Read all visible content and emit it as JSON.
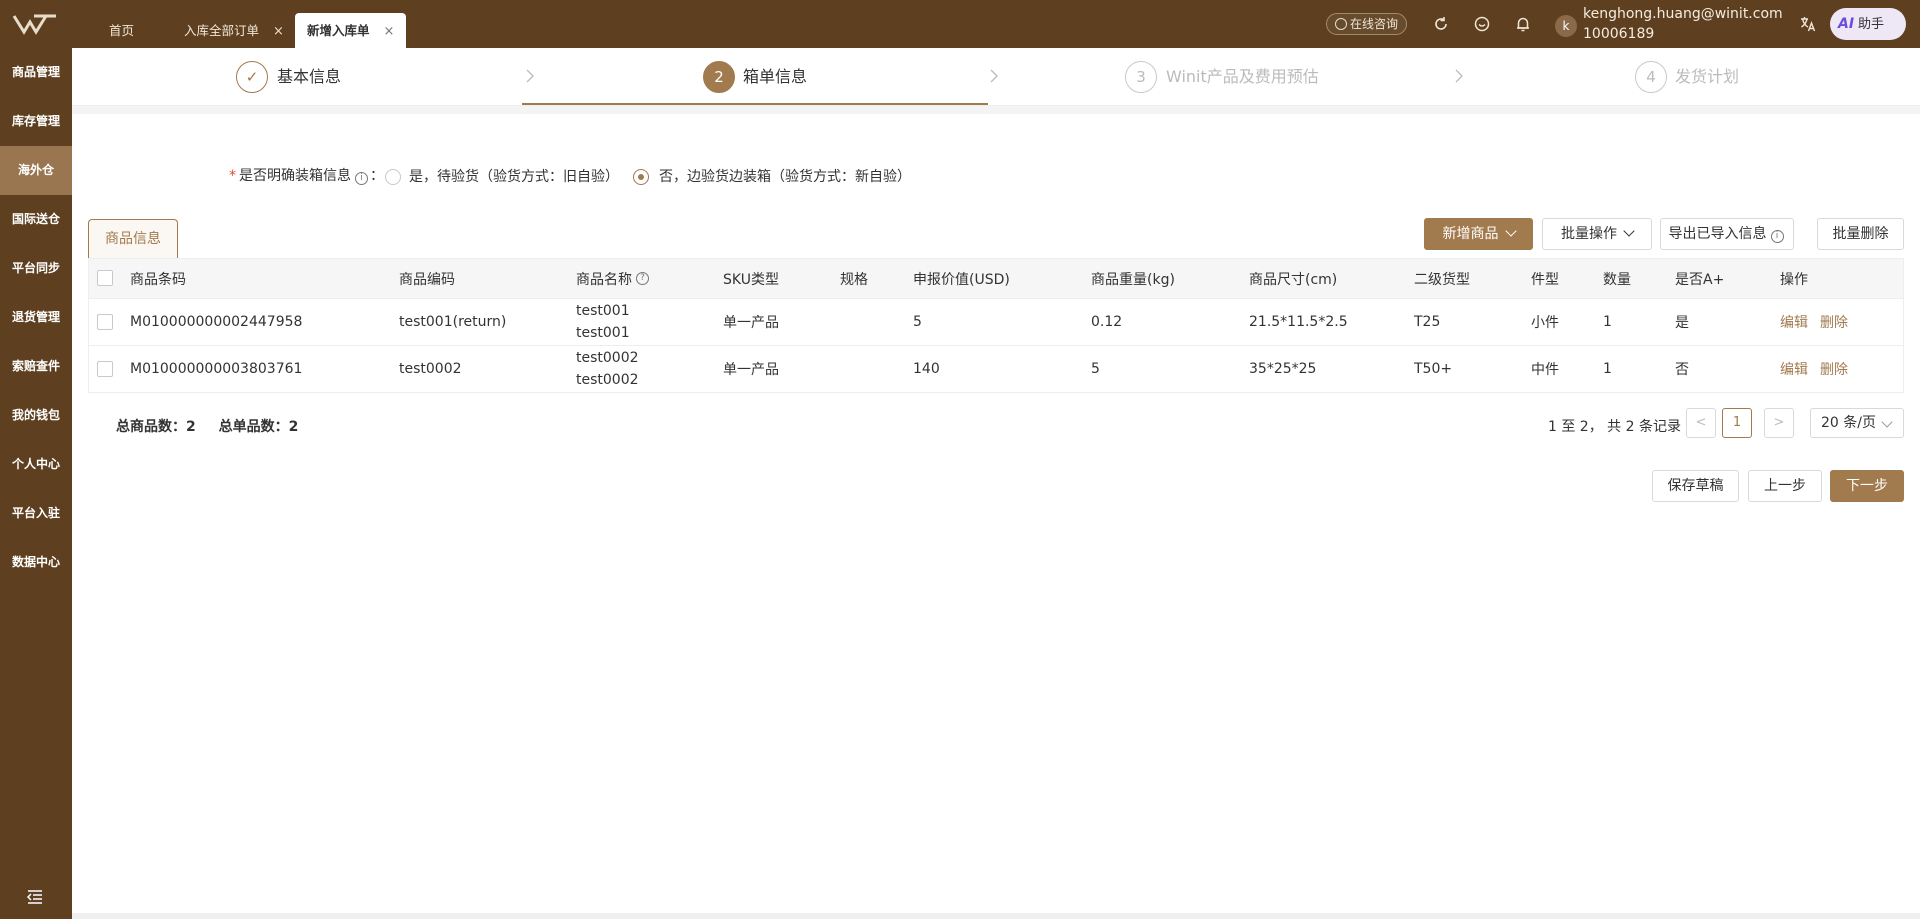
{
  "tabs": [
    {
      "label": "首页",
      "closable": false
    },
    {
      "label": "入库全部订单",
      "closable": true
    },
    {
      "label": "新增入库单",
      "closable": true,
      "active": true
    }
  ],
  "header": {
    "consult_label": "在线咨询",
    "user_avatar": "k",
    "user_email": "kenghong.huang@winit.com",
    "user_id": "10006189",
    "ai_prefix": "AI",
    "ai_label": "助手",
    "close_glyph": "×"
  },
  "sidebar": {
    "items": [
      {
        "label": "商品管理"
      },
      {
        "label": "库存管理"
      },
      {
        "label": "海外仓",
        "active": true
      },
      {
        "label": "国际送仓"
      },
      {
        "label": "平台同步"
      },
      {
        "label": "退货管理"
      },
      {
        "label": "索赔查件"
      },
      {
        "label": "我的钱包"
      },
      {
        "label": "个人中心"
      },
      {
        "label": "平台入驻"
      },
      {
        "label": "数据中心"
      }
    ]
  },
  "steps": [
    {
      "number": "✓",
      "label": "基本信息",
      "state": "done"
    },
    {
      "number": "2",
      "label": "箱单信息",
      "state": "current"
    },
    {
      "number": "3",
      "label": "Winit产品及费用预估",
      "state": "todo"
    },
    {
      "number": "4",
      "label": "发货计划",
      "state": "todo"
    }
  ],
  "form": {
    "required_mark": "*",
    "question": "是否明确装箱信息",
    "question_suffix": "：",
    "info_glyph": "i",
    "options": [
      {
        "label": "是，待验货（验货方式：旧自验）",
        "selected": false
      },
      {
        "label": "否，边验货边装箱（验货方式：新自验）",
        "selected": true
      }
    ]
  },
  "section_tab": "商品信息",
  "toolbar": {
    "add_product": "新增商品",
    "batch_ops": "批量操作",
    "export_imported": "导出已导入信息",
    "batch_delete": "批量删除"
  },
  "table": {
    "headers": [
      "商品条码",
      "商品编码",
      "商品名称",
      "SKU类型",
      "规格",
      "申报价值(USD)",
      "商品重量(kg)",
      "商品尺寸(cm)",
      "二级货型",
      "件型",
      "数量",
      "是否A+",
      "操作"
    ],
    "help_glyph": "?",
    "rows": [
      {
        "barcode": "M010000000002447958",
        "code": "test001(return)",
        "name1": "test001",
        "name2": "test001",
        "sku_type": "单一产品",
        "spec": "",
        "value": "5",
        "weight": "0.12",
        "size": "21.5*11.5*2.5",
        "cargo": "T25",
        "piece": "小件",
        "qty": "1",
        "a_plus": "是",
        "edit": "编辑",
        "delete": "删除"
      },
      {
        "barcode": "M010000000003803761",
        "code": "test0002",
        "name1": "test0002",
        "name2": "test0002",
        "sku_type": "单一产品",
        "spec": "",
        "value": "140",
        "weight": "5",
        "size": "35*25*25",
        "cargo": "T50+",
        "piece": "中件",
        "qty": "1",
        "a_plus": "否",
        "edit": "编辑",
        "delete": "删除"
      }
    ]
  },
  "summary": {
    "total_products_label": "总商品数：",
    "total_products": "2",
    "total_single_label": "总单品数：",
    "total_single": "2"
  },
  "pagination": {
    "info": "1 至 2，  共 2 条记录",
    "prev": "<",
    "current": "1",
    "next": ">",
    "page_size": "20 条/页"
  },
  "actions": {
    "save_draft": "保存草稿",
    "prev_step": "上一步",
    "next_step": "下一步"
  },
  "colors": {
    "brand_dark": "#5e4020",
    "accent": "#a17a4e",
    "required": "#e04a3a"
  }
}
